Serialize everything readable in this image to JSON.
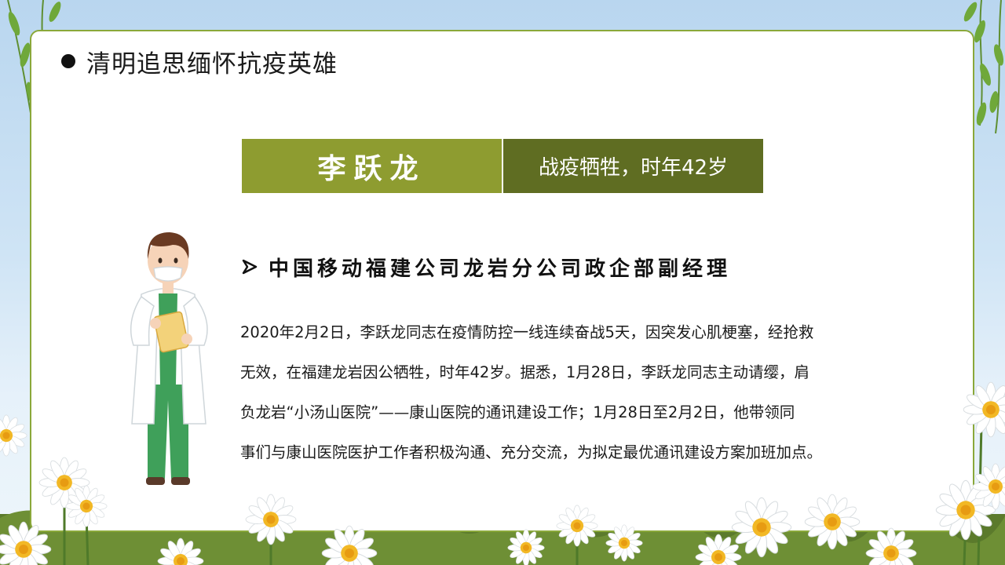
{
  "slide": {
    "headline": "清明追思缅怀抗疫英雄",
    "name": "李跃龙",
    "note": "战疫牺牲，时年42岁",
    "position_title": "中国移动福建公司龙岩分公司政企部副经理",
    "paragraph_lines": [
      "2020年2月2日，李跃龙同志在疫情防控一线连续奋战5天，因突发心肌梗塞，经抢救",
      "无效，在福建龙岩因公牺牲，时年42岁。据悉，1月28日，李跃龙同志主动请缨，肩",
      "负龙岩“小汤山医院”——康山医院的通讯建设工作；1月28日至2月2日，他带领同",
      "事们与康山医院医护工作者积极沟通、充分交流，为拟定最优通讯建设方案加班加点。"
    ]
  },
  "icons": {
    "bullet": "bullet-dot-icon",
    "arrow": "arrow-bullet-icon",
    "doctor": "doctor-illustration",
    "decor": [
      "willow-branch",
      "daisy-flower",
      "grass-strip"
    ]
  },
  "colors": {
    "name_bg": "#8e9c30",
    "note_bg": "#5f6d22",
    "card_border": "#8aa83a",
    "sky": "#b9d6ef",
    "grass": "#5b7a2c"
  }
}
